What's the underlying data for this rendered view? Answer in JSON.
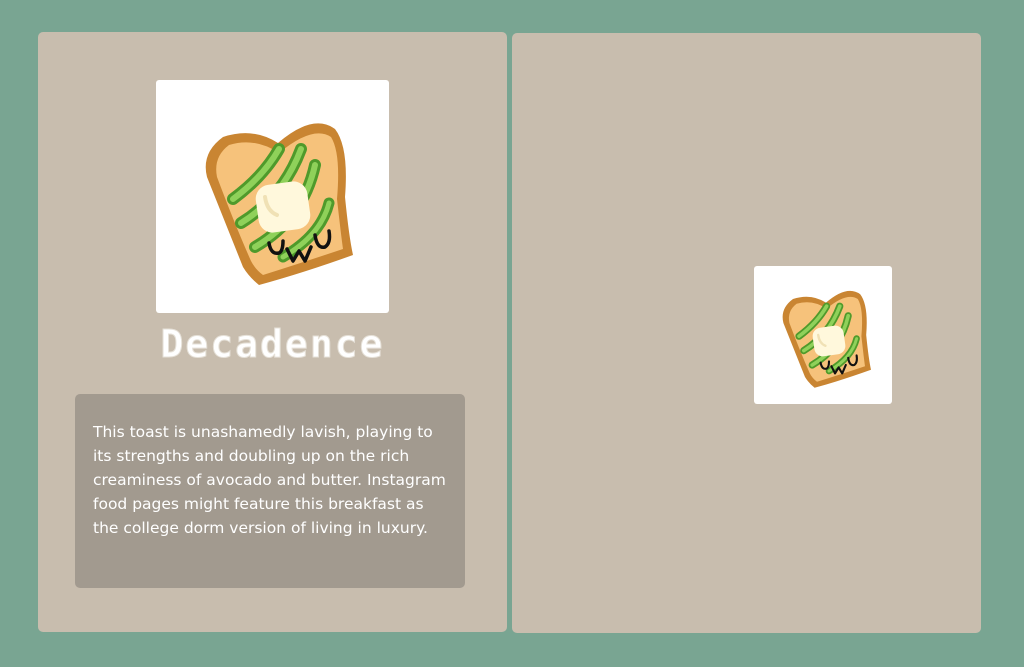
{
  "card": {
    "title": "Decadence",
    "description": "This toast is unashamedly lavish, playing to its strengths and doubling up on the rich creaminess of avocado and butter. Instagram food pages might feature this breakfast as the college dorm version of living in luxury.",
    "image": {
      "icon": "avocado-toast-icon",
      "face_text": "UwU"
    }
  },
  "preview": {
    "image": {
      "icon": "avocado-toast-icon",
      "face_text": "UwU"
    }
  },
  "colors": {
    "background": "#79a592",
    "panel": "#c8bdae",
    "description_box": "#a29a8f",
    "toast_crust": "#c98532",
    "toast_inner": "#f6c27b",
    "avocado": "#6fbf3f",
    "butter": "#fff8dc"
  }
}
